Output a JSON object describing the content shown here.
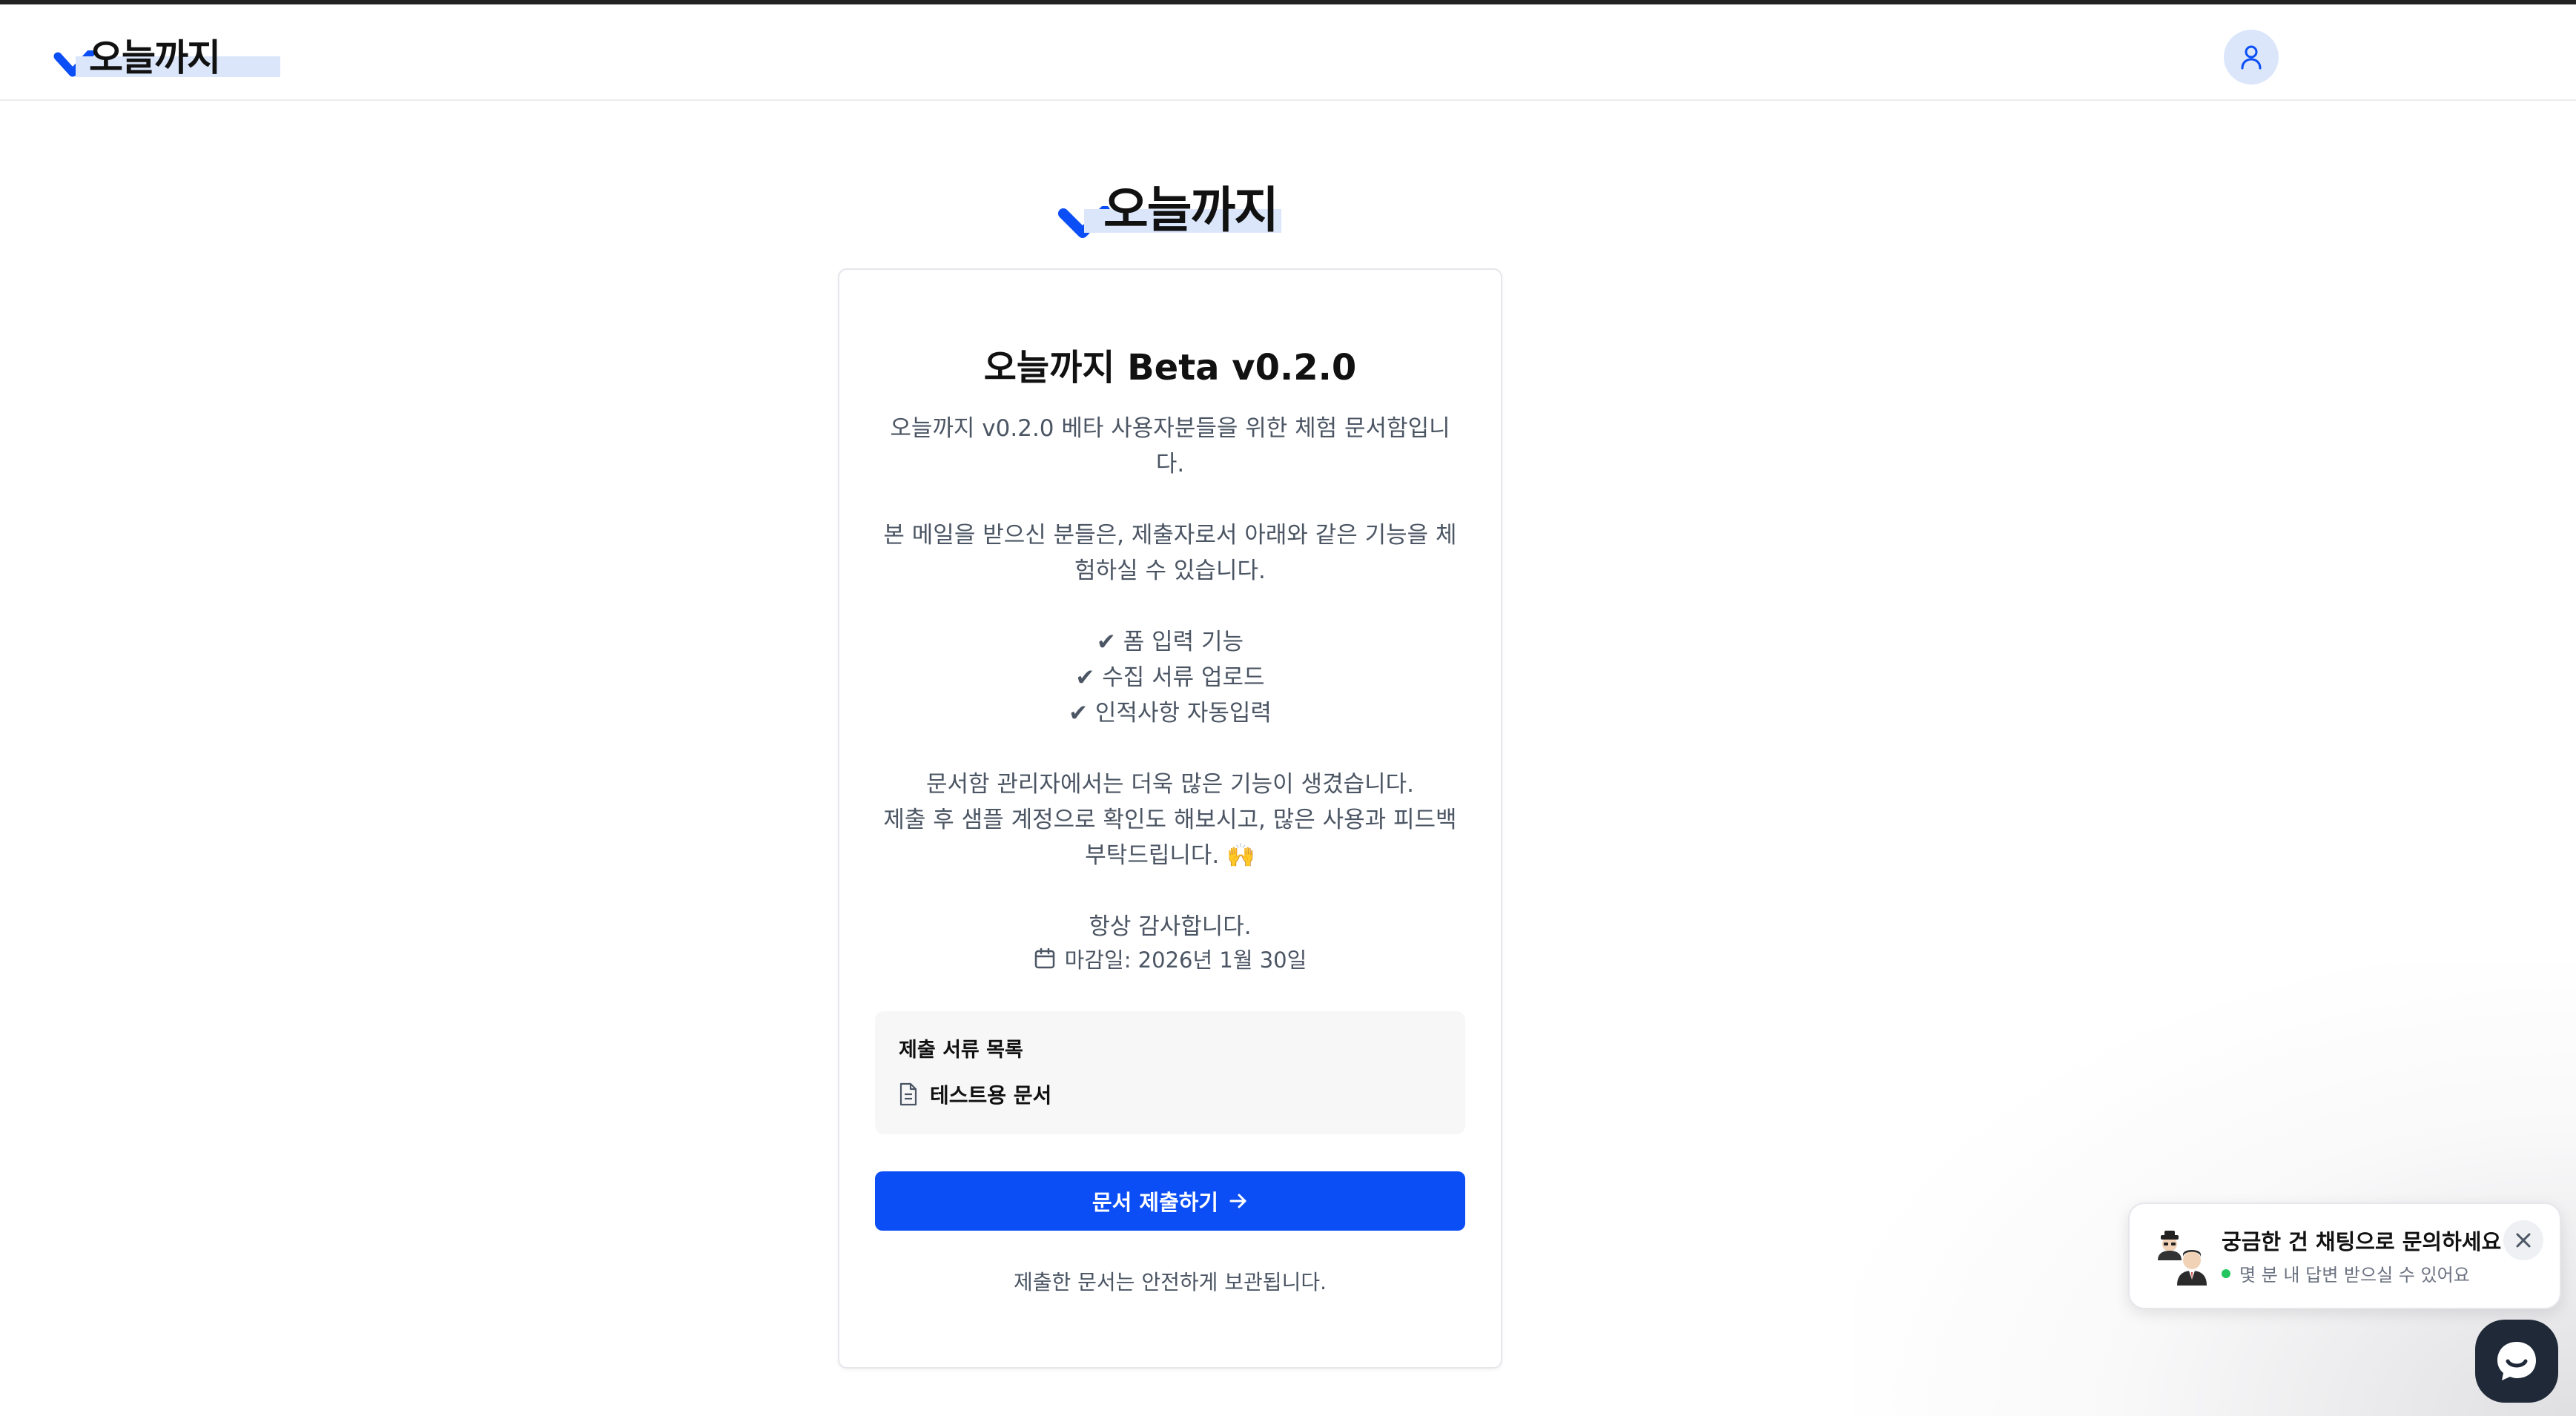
{
  "header": {
    "logo_text": "오늘까지",
    "profile_icon": "user-icon"
  },
  "brand": {
    "accent": "#0b4ef5",
    "logo_highlight": "#dbe6fb"
  },
  "main": {
    "logo_text": "오늘까지",
    "card": {
      "title": "오늘까지 Beta v0.2.0",
      "intro": "오늘까지 v0.2.0 베타 사용자분들을 위한 체험 문서함입니다.",
      "para2": "본 메일을 받으신 분들은, 제출자로서 아래와 같은 기능을 체험하실 수 있습니다.",
      "features": [
        "✔ 폼 입력 기능",
        "✔ 수집 서류 업로드",
        "✔ 인적사항 자동입력"
      ],
      "para3_line1": "문서함 관리자에서는 더욱 많은 기능이 생겼습니다.",
      "para3_line2": "제출 후 샘플 계정으로 확인도 해보시고, 많은 사용과 피드백 부탁드립니다. 🙌",
      "thanks": "항상 감사합니다.",
      "deadline": "마감일: 2026년 1월 30일",
      "doc_list_title": "제출 서류 목록",
      "documents": [
        "테스트용 문서"
      ],
      "submit_label": "문서 제출하기",
      "footnote": "제출한 문서는 안전하게 보관됩니다."
    }
  },
  "chat": {
    "title": "궁금한 건 채팅으로 문의하세요",
    "subtitle": "몇 분 내 답변 받으실 수 있어요",
    "status_color": "#22c55e"
  }
}
